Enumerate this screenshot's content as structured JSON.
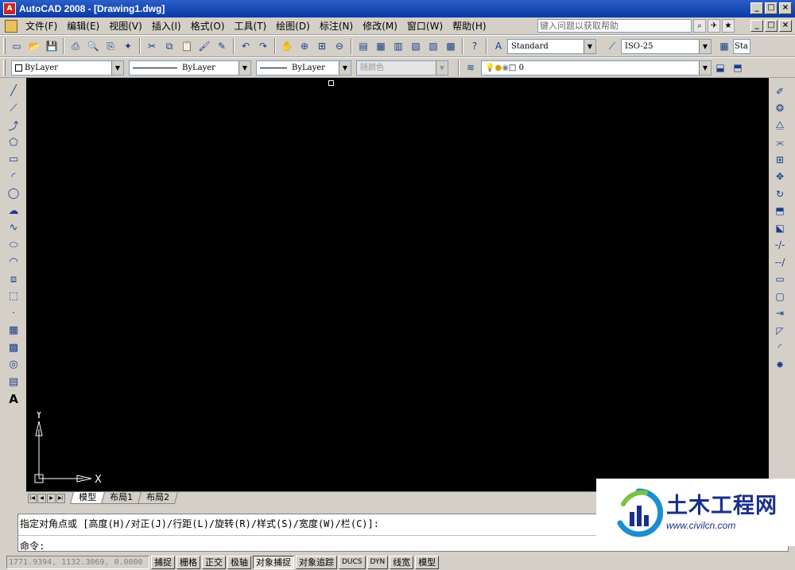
{
  "window": {
    "title": "AutoCAD 2008 - [Drawing1.dwg]",
    "controls": [
      "_",
      "□",
      "×"
    ]
  },
  "menu": {
    "items": [
      "文件(F)",
      "编辑(E)",
      "视图(V)",
      "插入(I)",
      "格式(O)",
      "工具(T)",
      "绘图(D)",
      "标注(N)",
      "修改(M)",
      "窗口(W)",
      "帮助(H)"
    ],
    "help_placeholder": "键入问题以获取帮助"
  },
  "toolbar": {
    "text_style": "Standard",
    "dim_style": "ISO-25",
    "table_style_partial": "Sta"
  },
  "properties": {
    "color": "ByLayer",
    "linetype": "ByLayer",
    "lineweight": "ByLayer",
    "plot_style": "随颜色",
    "layer": "0"
  },
  "ucs": {
    "x_label": "X",
    "y_label": "Y"
  },
  "tabs": [
    "模型",
    "布局1",
    "布局2"
  ],
  "command": {
    "line1": "指定对角点或 [高度(H)/对正(J)/行距(L)/旋转(R)/样式(S)/宽度(W)/栏(C)]:",
    "line2": "命令:"
  },
  "status": {
    "coordinates": "1771.9394, 1132.3069, 0.0000",
    "buttons": [
      "捕捉",
      "栅格",
      "正交",
      "极轴",
      "对象捕捉",
      "对象追踪",
      "DUCS",
      "DYN",
      "线宽",
      "模型"
    ]
  },
  "watermark": {
    "name": "土木工程网",
    "url": "www.civilcn.com"
  },
  "colors": {
    "canvas": "#000000",
    "titlebar": "#0a3aa6",
    "watermark": "#1a2f8a"
  }
}
